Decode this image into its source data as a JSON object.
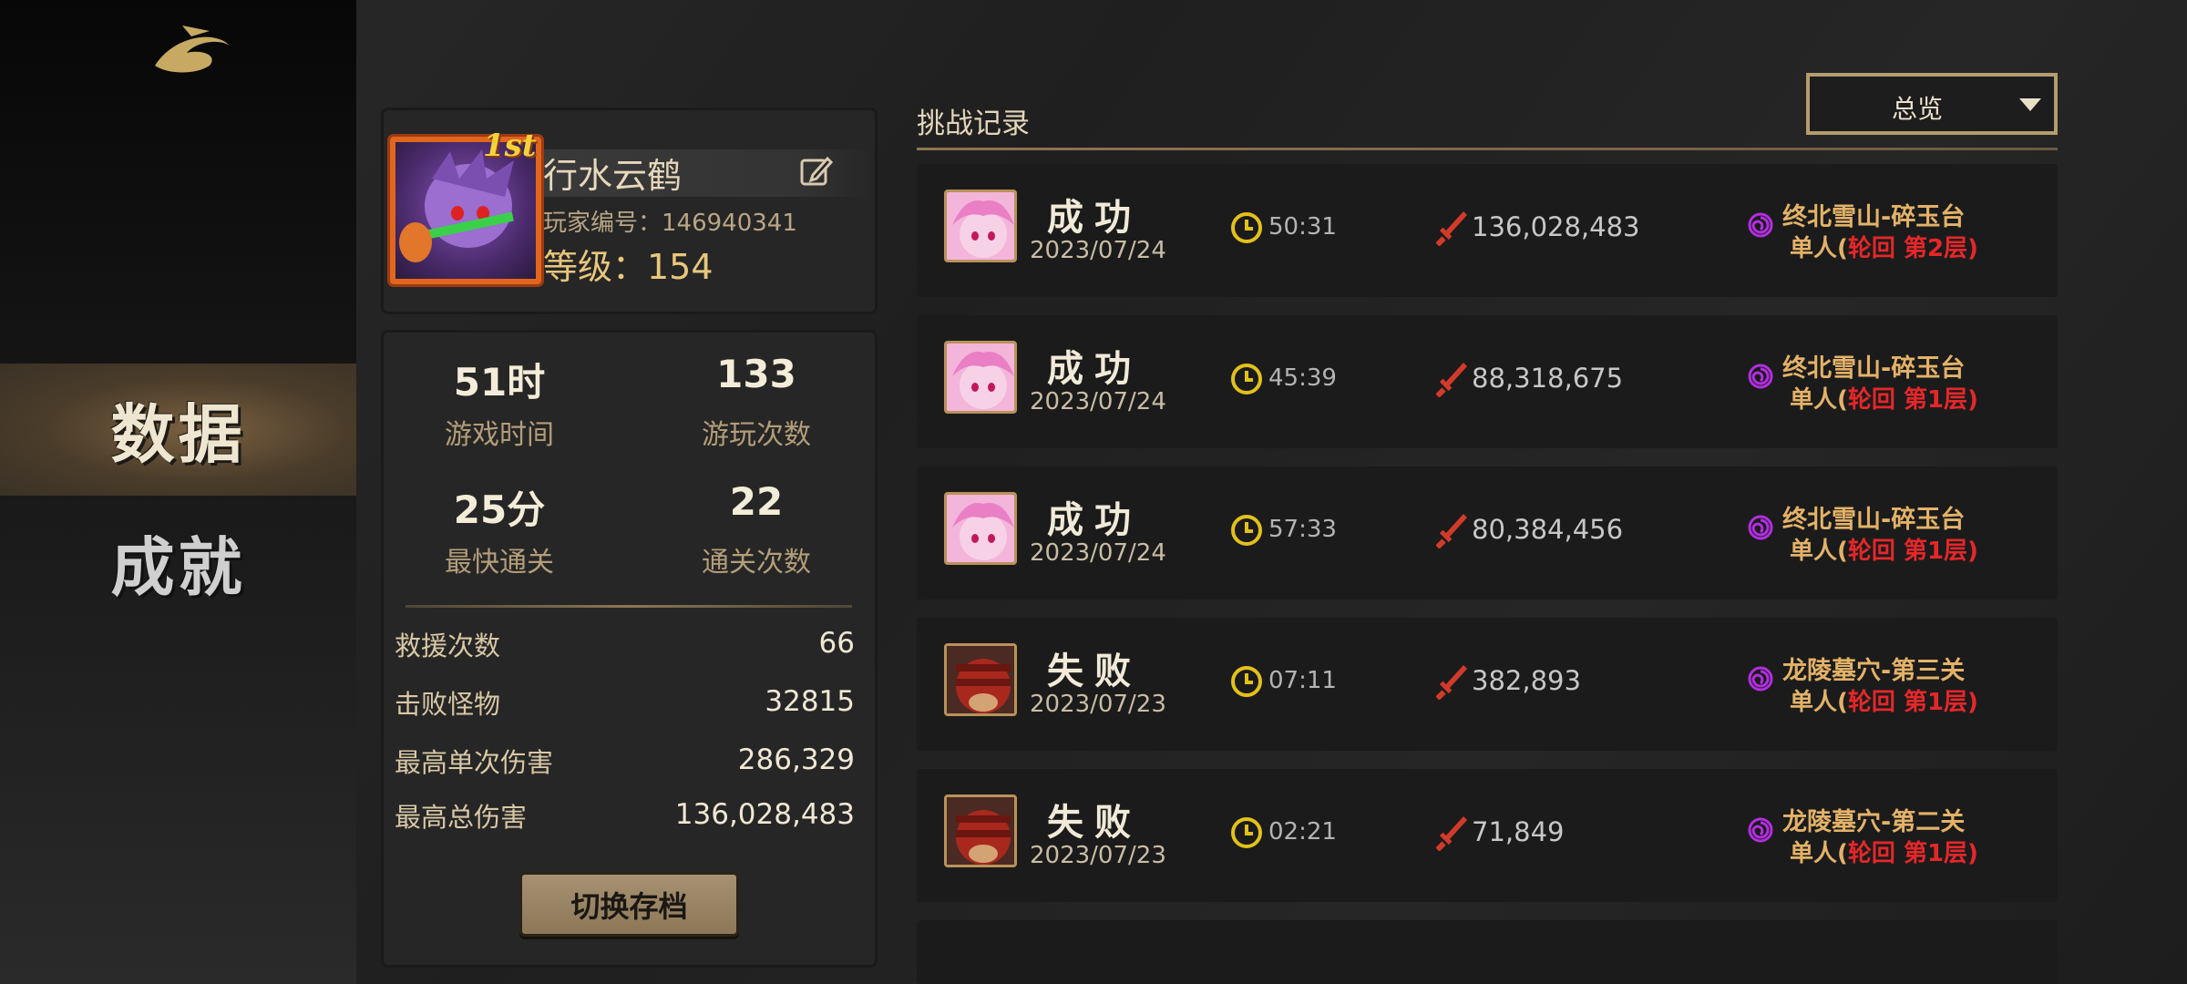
{
  "nav": {
    "items": [
      {
        "label": "数据",
        "active": true
      },
      {
        "label": "成就",
        "active": false
      }
    ]
  },
  "profile": {
    "rank_badge": "1st",
    "name": "行水云鹤",
    "id_text": "玩家编号：146940341",
    "level_text": "等级：154"
  },
  "stats": {
    "grid": [
      {
        "value": "51时",
        "label": "游戏时间"
      },
      {
        "value": "133",
        "label": "游玩次数"
      },
      {
        "value": "25分",
        "label": "最快通关"
      },
      {
        "value": "22",
        "label": "通关次数"
      }
    ],
    "rows": [
      {
        "label": "救援次数",
        "value": "66"
      },
      {
        "label": "击败怪物",
        "value": "32815"
      },
      {
        "label": "最高单次伤害",
        "value": "286,329"
      },
      {
        "label": "最高总伤害",
        "value": "136,028,483"
      }
    ],
    "switch_button": "切换存档"
  },
  "records": {
    "title": "挑战记录",
    "filter": "总览",
    "items": [
      {
        "status": "成功",
        "date": "2023/07/24",
        "time": "50:31",
        "damage": "136,028,483",
        "map": "终北雪山-碎玉台",
        "mode_prefix": "单人(",
        "mode_red": "轮回 第2层)",
        "avatar": "pink"
      },
      {
        "status": "成功",
        "date": "2023/07/24",
        "time": "45:39",
        "damage": "88,318,675",
        "map": "终北雪山-碎玉台",
        "mode_prefix": "单人(",
        "mode_red": "轮回 第1层)",
        "avatar": "pink"
      },
      {
        "status": "成功",
        "date": "2023/07/24",
        "time": "57:33",
        "damage": "80,384,456",
        "map": "终北雪山-碎玉台",
        "mode_prefix": "单人(",
        "mode_red": "轮回 第1层)",
        "avatar": "pink"
      },
      {
        "status": "失败",
        "date": "2023/07/23",
        "time": "07:11",
        "damage": "382,893",
        "map": "龙陵墓穴-第三关",
        "mode_prefix": "单人(",
        "mode_red": "轮回 第1层)",
        "avatar": "red"
      },
      {
        "status": "失败",
        "date": "2023/07/23",
        "time": "02:21",
        "damage": "71,849",
        "map": "龙陵墓穴-第二关",
        "mode_prefix": "单人(",
        "mode_red": "轮回 第1层)",
        "avatar": "red"
      }
    ]
  },
  "colors": {
    "accent_gold": "#e3b268",
    "mode_red": "#e5272a",
    "clock_yellow": "#e2c11a",
    "swirl_purple": "#b22ee0"
  }
}
